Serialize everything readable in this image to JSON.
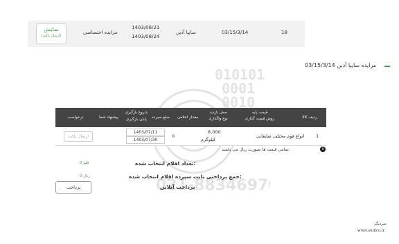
{
  "top_row": {
    "number": "18",
    "code": "03/15/3/14",
    "company": "سایپا آذین",
    "date_start": "1403/08/21",
    "date_end": "1403/08/24",
    "type": "مزایده اختصاصی",
    "show_button": "نمایش",
    "show_button_sub": "(ارسال پاکت)"
  },
  "heading": "مزایده سایپا آذین 03/15/3/14",
  "table": {
    "headers": {
      "row_item": "ردیف کالا",
      "base_price": "قیمت پایه",
      "pricing_method": "روش قیمت گذاری",
      "delivery_place": "محل بازدید",
      "delivery_type": "نوع واگذاری",
      "announced_qty": "مقدار اعلامی",
      "deposit_amount": "مبلغ سپرده",
      "visit_start": "شروع بازگیری",
      "visit_end": "پایان بازگیری",
      "your_offer": "پیشنهاد شما",
      "request": "درخواست"
    },
    "rows": [
      {
        "row": "1",
        "item": "انواع فوم مختلف ضایعاتی",
        "quantity": "8,000",
        "unit": "کیلوگرم",
        "deposit": "0",
        "date_start": "1403/07/11",
        "date_end": "1403/07/30",
        "send_button": "ارسال پاکت"
      }
    ]
  },
  "notice": "تمامی قیمت ها بصورت ریال می باشند.",
  "summary": {
    "selected_count_label": "تعداد اقلام انتخاب شده:",
    "selected_count_value": "0",
    "selected_count_unit": "قلم",
    "deposit_total_label": "جمع پرداختی بابت سپرده اقلام انتخاب شده:",
    "deposit_total_value": "0",
    "deposit_total_unit": "ریال"
  },
  "online_payment_label": "پرداخت آنلاین",
  "pay_button": "پرداخت",
  "footer": {
    "source": "سردیگر",
    "website": "www.sudico.ir"
  },
  "colors": {
    "accent": "#4a9a4a",
    "table_header": "#444444"
  },
  "icons": {
    "info": "info-icon"
  }
}
